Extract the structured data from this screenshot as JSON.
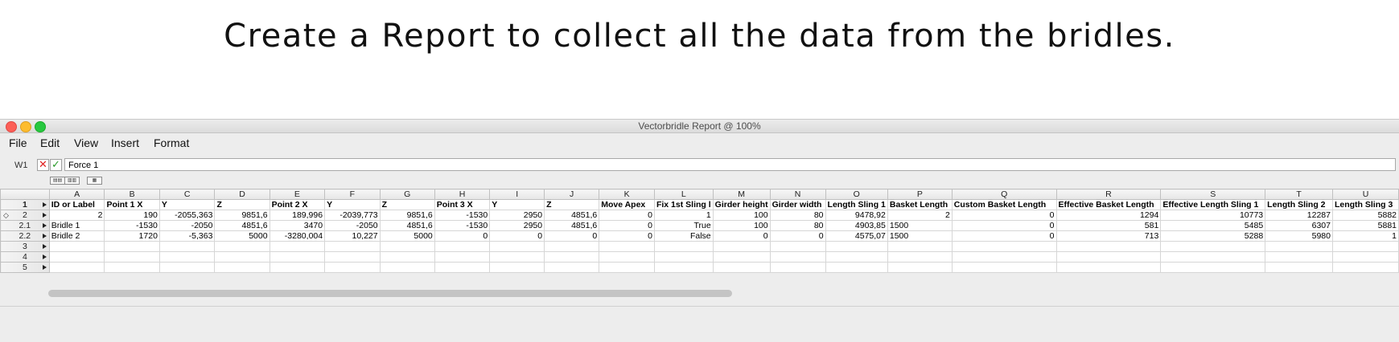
{
  "headline": "Create a Report to collect all the data from the bridles.",
  "window": {
    "title": "Vectorbridle Report @ 100%"
  },
  "menu": [
    "File",
    "Edit",
    "View",
    "Insert",
    "Format"
  ],
  "formula_bar": {
    "cell_ref": "W1",
    "cancel_symbol": "✕",
    "accept_symbol": "✓",
    "value": "Force 1"
  },
  "toolbar_buttons": [
    "insert-rows-icon",
    "insert-chart-icon",
    "sort-icon"
  ],
  "columns": [
    "A",
    "B",
    "C",
    "D",
    "E",
    "F",
    "G",
    "H",
    "I",
    "J",
    "K",
    "L",
    "M",
    "N",
    "O",
    "P",
    "Q",
    "R",
    "S",
    "T",
    "U"
  ],
  "rows": [
    {
      "header": "1",
      "cells": [
        "ID or Label",
        "Point 1 X",
        "Y",
        "Z",
        "Point 2 X",
        "Y",
        "Z",
        "Point 3 X",
        "Y",
        "Z",
        "Move Apex",
        "Fix 1st Sling l",
        "Girder height",
        "Girder width",
        "Length Sling 1",
        "Basket Length",
        "Custom Basket Length",
        "Effective Basket Length",
        "Effective Length Sling 1",
        "Length Sling 2",
        "Length Sling 3"
      ]
    },
    {
      "header": "2",
      "cells": [
        "2",
        "190",
        "-2055,363",
        "9851,6",
        "189,996",
        "-2039,773",
        "9851,6",
        "-1530",
        "2950",
        "4851,6",
        "0",
        "1",
        "100",
        "80",
        "9478,92",
        "2",
        "0",
        "1294",
        "10773",
        "12287",
        "5882"
      ]
    },
    {
      "header": "2.1",
      "cells": [
        "Bridle 1",
        "-1530",
        "-2050",
        "4851,6",
        "3470",
        "-2050",
        "4851,6",
        "-1530",
        "2950",
        "4851,6",
        "0",
        "True",
        "100",
        "80",
        "4903,85",
        "1500",
        "0",
        "581",
        "5485",
        "6307",
        "5881"
      ]
    },
    {
      "header": "2.2",
      "cells": [
        "Bridle 2",
        "1720",
        "-5,363",
        "5000",
        "-3280,004",
        "10,227",
        "5000",
        "0",
        "0",
        "0",
        "0",
        "False",
        "0",
        "0",
        "4575,07",
        "1500",
        "0",
        "713",
        "5288",
        "5980",
        "1"
      ]
    },
    {
      "header": "3",
      "cells": [
        "",
        "",
        "",
        "",
        "",
        "",
        "",
        "",
        "",
        "",
        "",
        "",
        "",
        "",
        "",
        "",
        "",
        "",
        "",
        "",
        ""
      ]
    },
    {
      "header": "4",
      "cells": [
        "",
        "",
        "",
        "",
        "",
        "",
        "",
        "",
        "",
        "",
        "",
        "",
        "",
        "",
        "",
        "",
        "",
        "",
        "",
        "",
        ""
      ]
    },
    {
      "header": "5",
      "cells": [
        "",
        "",
        "",
        "",
        "",
        "",
        "",
        "",
        "",
        "",
        "",
        "",
        "",
        "",
        "",
        "",
        "",
        "",
        "",
        "",
        ""
      ]
    }
  ]
}
